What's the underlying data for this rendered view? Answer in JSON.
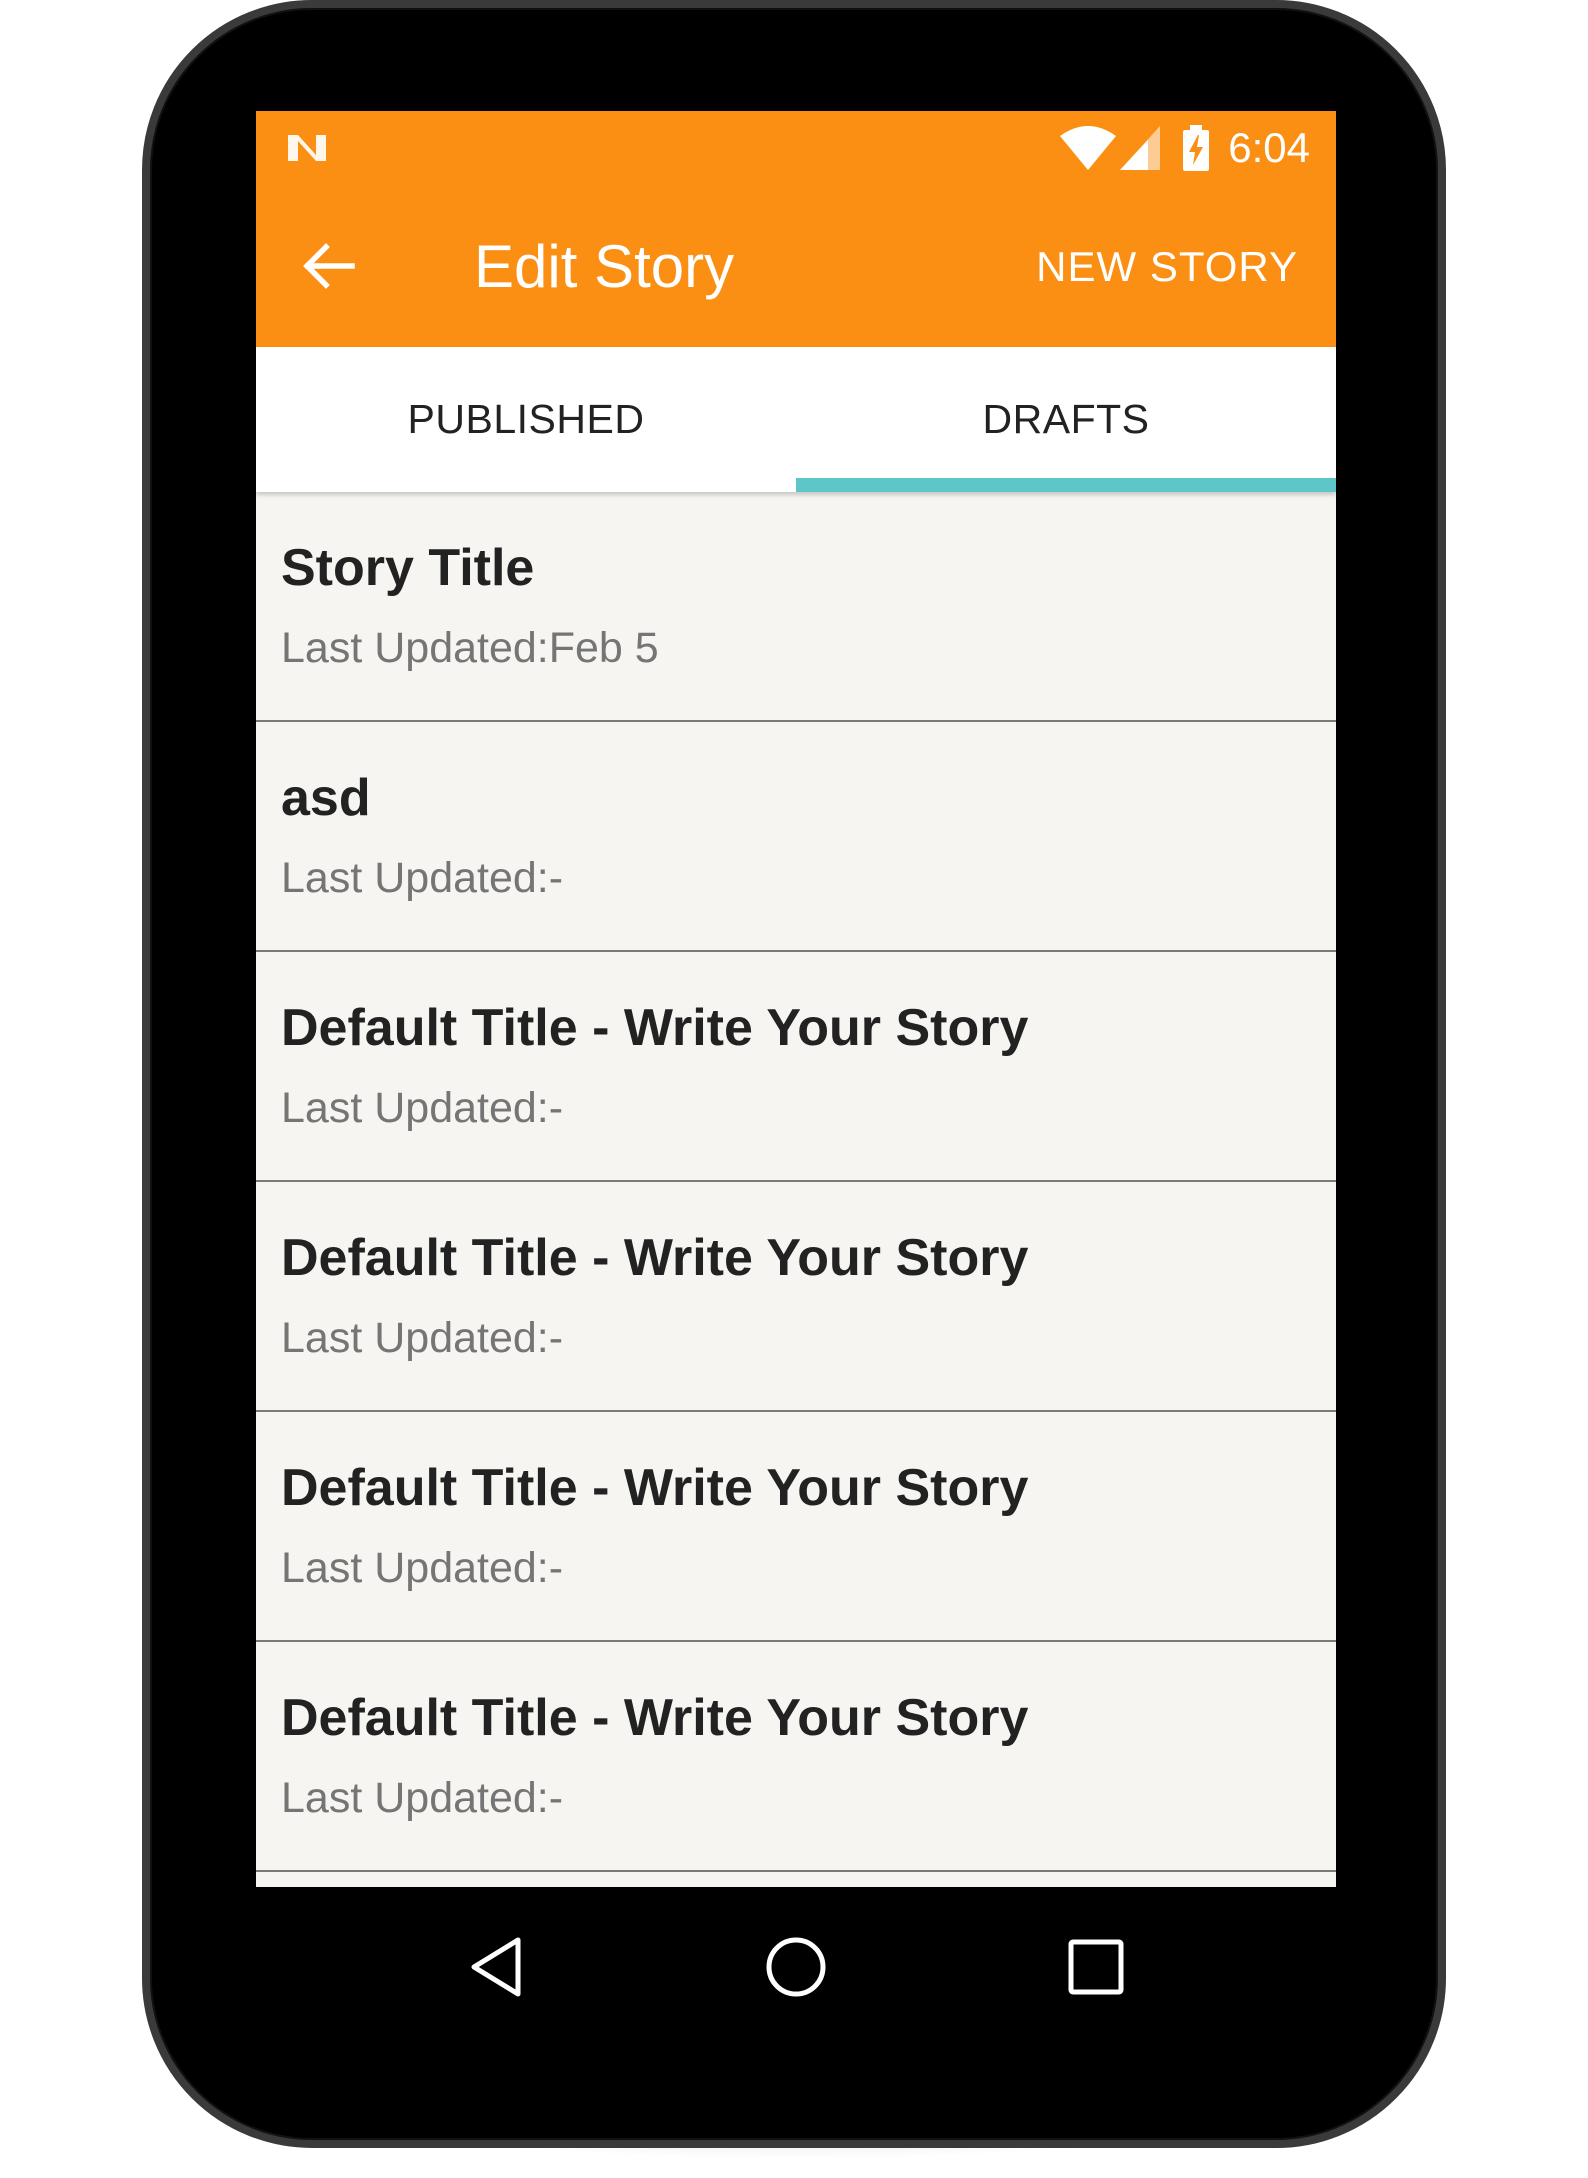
{
  "status_bar": {
    "time": "6:04",
    "icons": [
      "n-icon",
      "wifi-icon",
      "signal-icon",
      "battery-charging-icon"
    ]
  },
  "app_bar": {
    "title": "Edit Story",
    "action_label": "NEW STORY",
    "back_icon": "arrow-back-icon"
  },
  "tabs": [
    {
      "label": "PUBLISHED",
      "selected": false
    },
    {
      "label": "DRAFTS",
      "selected": true
    }
  ],
  "stories": [
    {
      "title": "Story Title",
      "subtitle": "Last Updated:Feb 5"
    },
    {
      "title": "asd",
      "subtitle": "Last Updated:-"
    },
    {
      "title": "Default Title - Write Your Story",
      "subtitle": "Last Updated:-"
    },
    {
      "title": "Default Title - Write Your Story",
      "subtitle": "Last Updated:-"
    },
    {
      "title": "Default Title - Write Your Story",
      "subtitle": "Last Updated:-"
    },
    {
      "title": "Default Title - Write Your Story",
      "subtitle": "Last Updated:-"
    }
  ],
  "nav_bar": {
    "icons": [
      "nav-back-icon",
      "nav-home-icon",
      "nav-recents-icon"
    ]
  },
  "colors": {
    "accent": "#fb8f14",
    "tab_indicator": "#5ec6c8",
    "list_background": "#f6f5f1"
  }
}
